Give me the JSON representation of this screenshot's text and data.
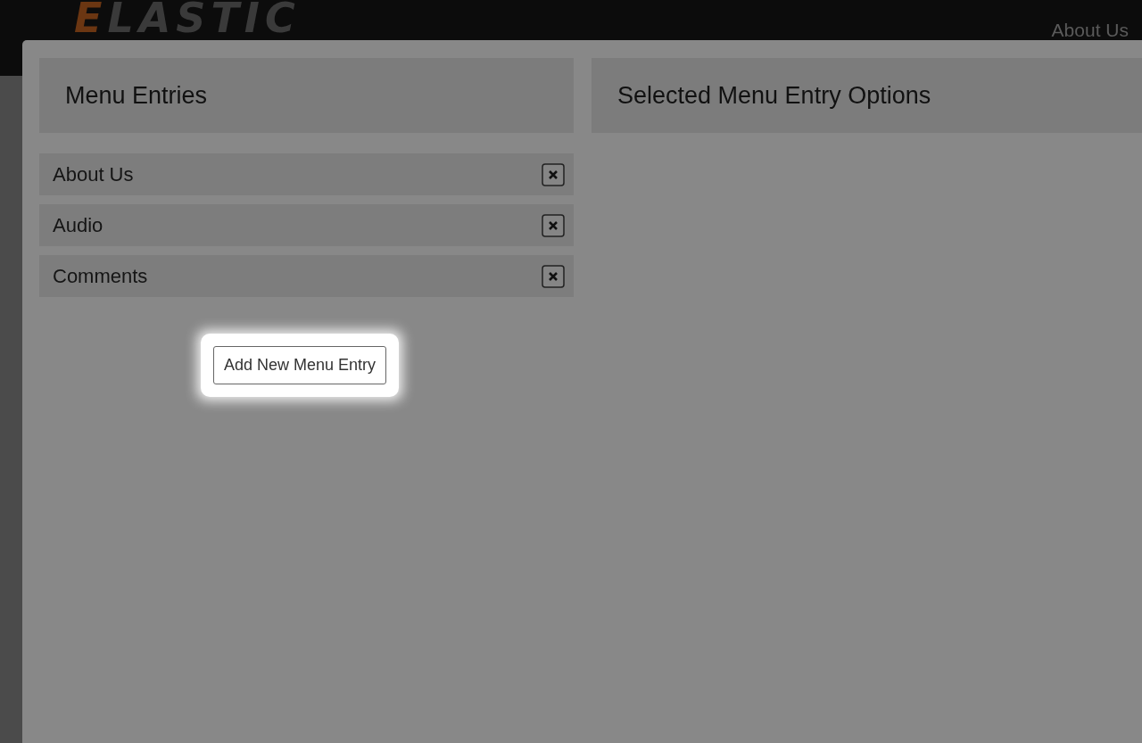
{
  "header": {
    "logo": "ELASTIC",
    "nav_link": "About Us"
  },
  "dialog": {
    "menu_panel": {
      "title": "Menu Entries",
      "entries": [
        {
          "label": "About Us"
        },
        {
          "label": "Audio"
        },
        {
          "label": "Comments"
        }
      ],
      "add_button": "Add New Menu Entry"
    },
    "options_panel": {
      "title": "Selected Menu Entry Options"
    }
  }
}
